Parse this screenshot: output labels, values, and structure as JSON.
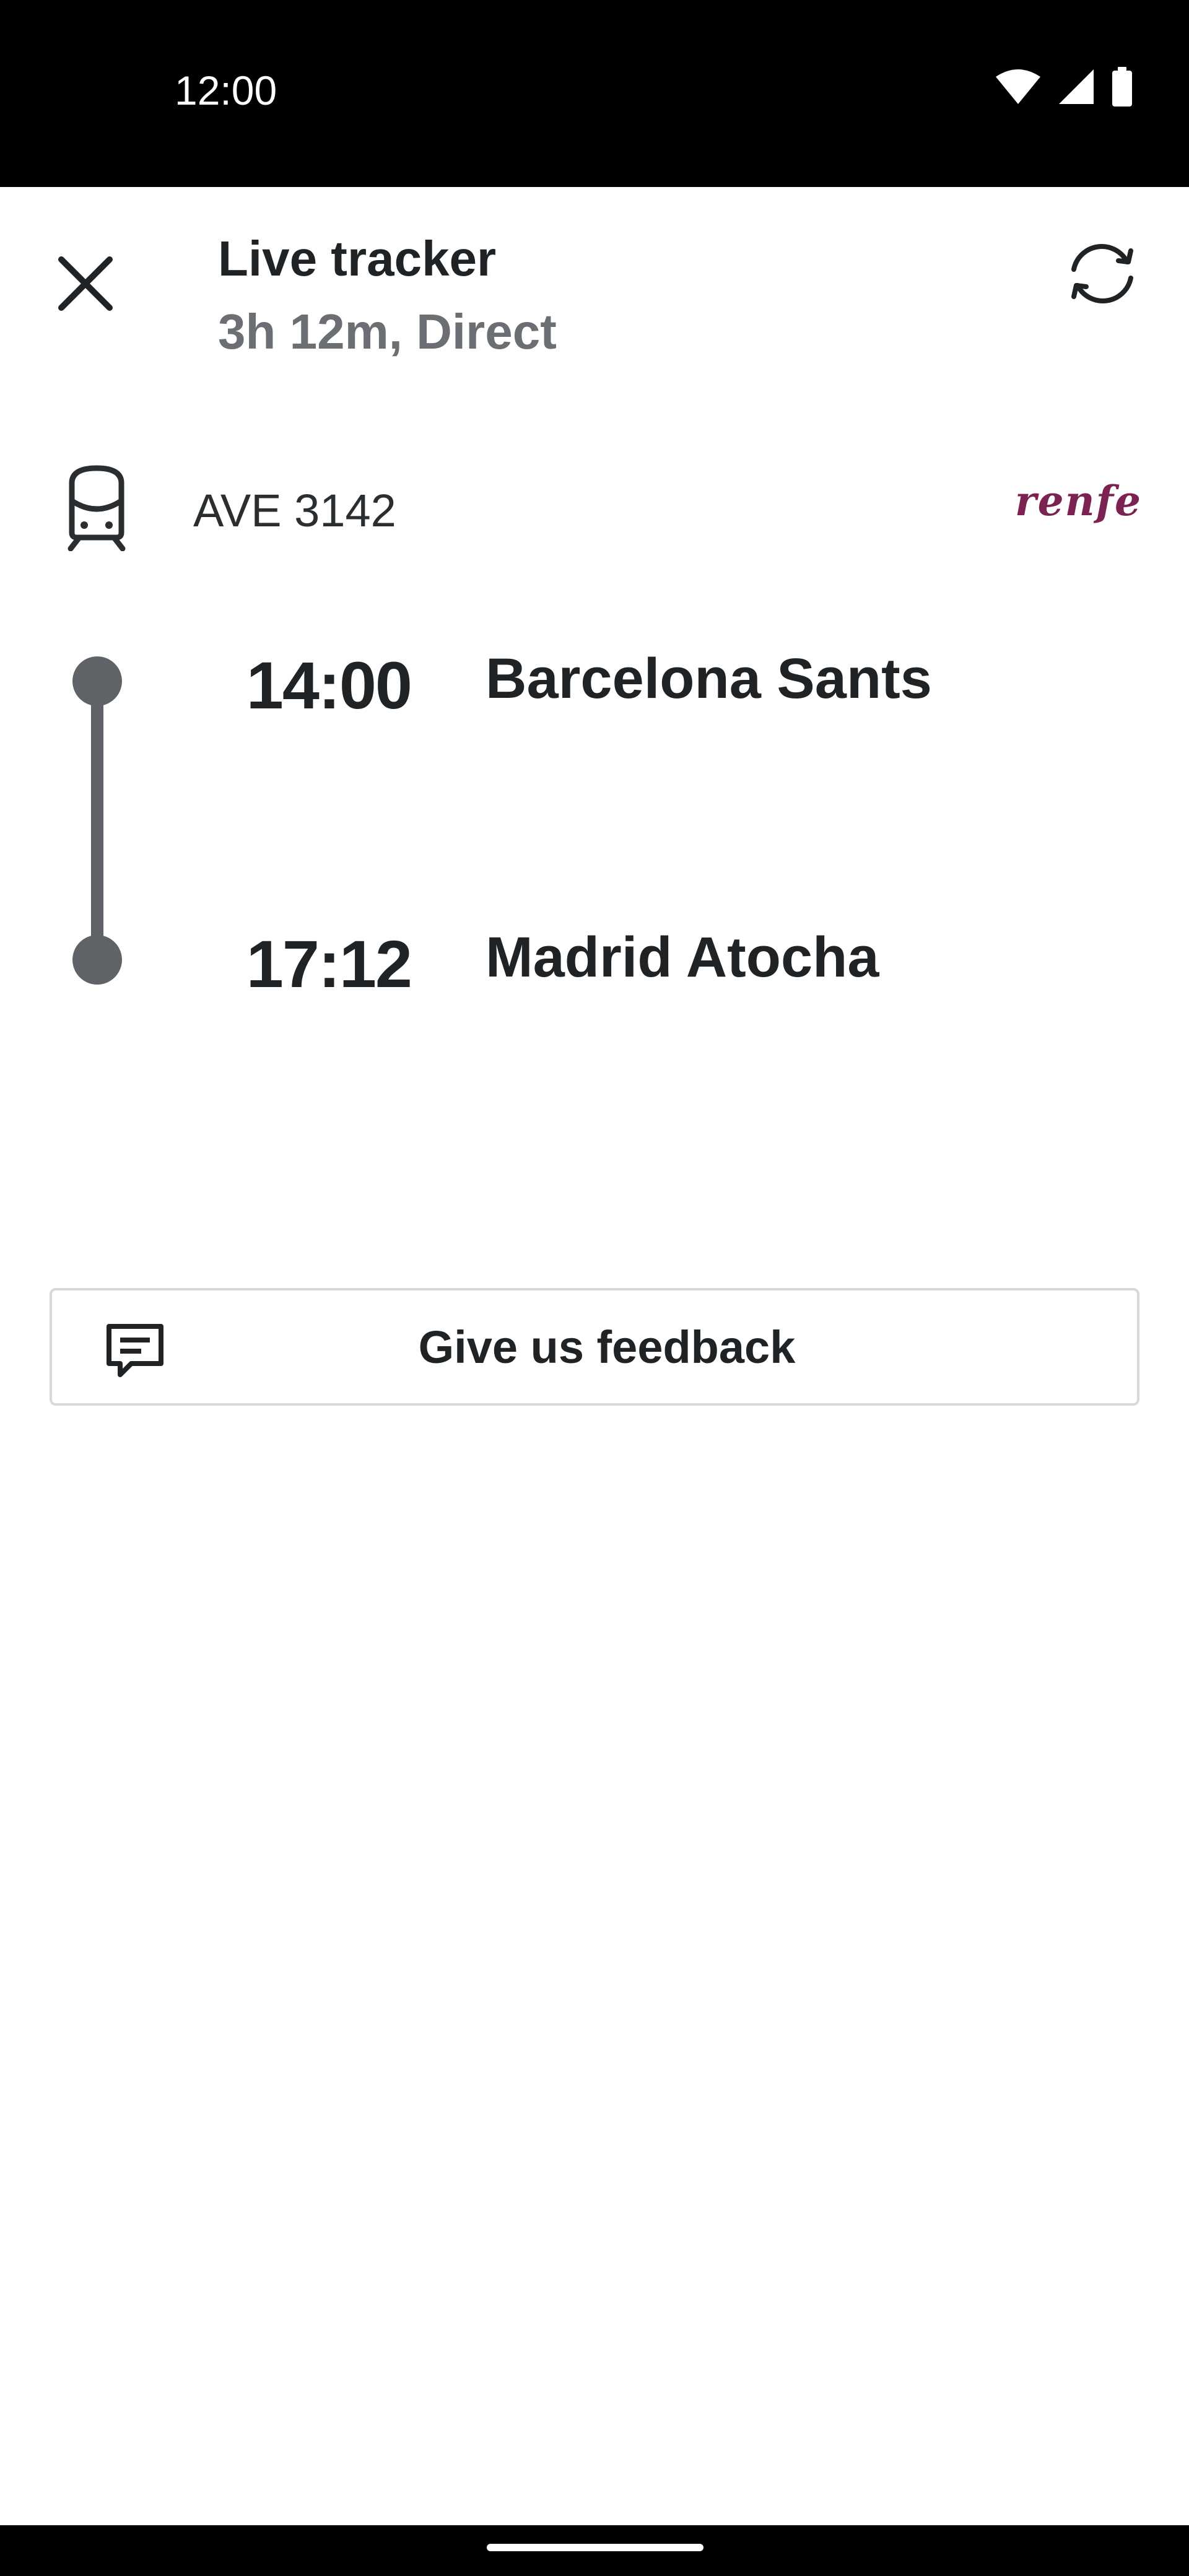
{
  "status_bar": {
    "time": "12:00",
    "icons": [
      "wifi-icon",
      "signal-icon",
      "battery-icon"
    ]
  },
  "header": {
    "title": "Live tracker",
    "subtitle": "3h 12m, Direct",
    "close_icon": "close-icon",
    "refresh_icon": "refresh-icon"
  },
  "train": {
    "icon": "train-icon",
    "number": "AVE 3142",
    "operator": "renfe",
    "operator_color": "#7b2252"
  },
  "route": {
    "stops": [
      {
        "time": "14:00",
        "station": "Barcelona Sants"
      },
      {
        "time": "17:12",
        "station": "Madrid Atocha"
      }
    ],
    "line_color": "#5f6368"
  },
  "feedback": {
    "label": "Give us feedback",
    "icon": "feedback-icon"
  }
}
